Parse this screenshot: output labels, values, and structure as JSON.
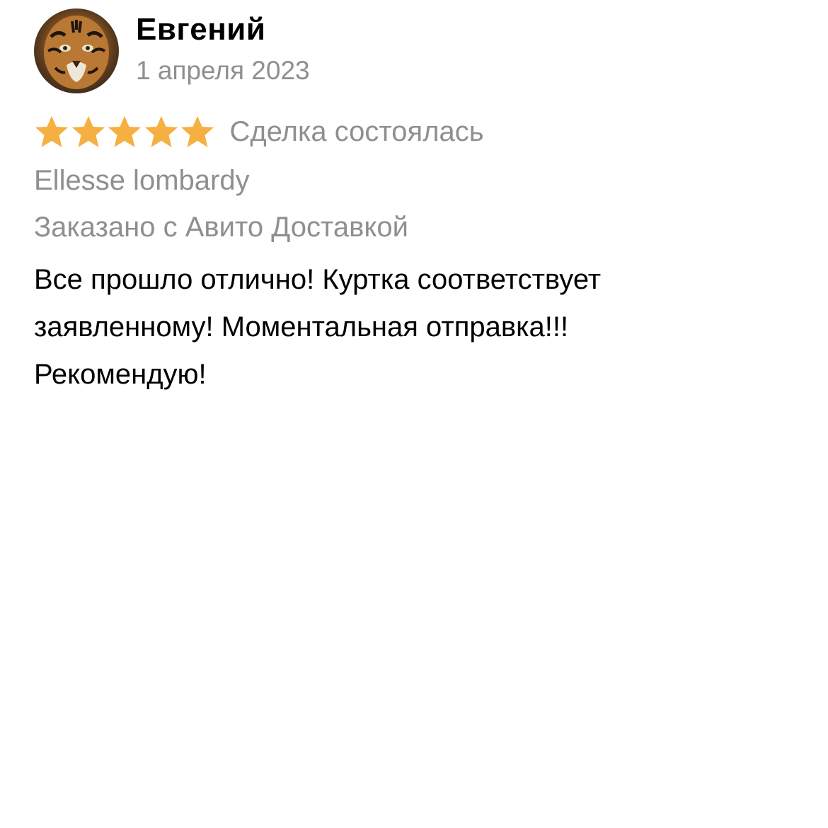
{
  "review": {
    "author_name": "Евгений",
    "date": "1 апреля 2023",
    "rating": 5,
    "rating_max": 5,
    "star_color": "#f5b041",
    "deal_status": "Сделка состоялась",
    "item_title": "Ellesse lombardy",
    "delivery_note": "Заказано с Авито Доставкой",
    "text": "Все прошло отлично! Куртка соответствует заявленному! Моментальная отправка!!! Рекомендую!",
    "avatar_icon": "tiger-avatar"
  }
}
